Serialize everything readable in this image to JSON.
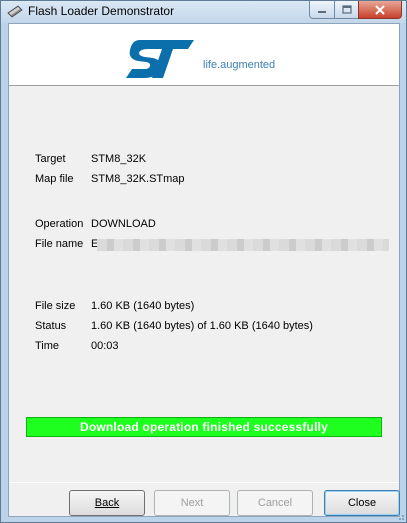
{
  "window": {
    "title": "Flash Loader Demonstrator"
  },
  "header": {
    "tagline": "life.augmented",
    "logo_icon": "st-logo"
  },
  "fields": {
    "target": {
      "label": "Target",
      "value": "STM8_32K"
    },
    "map_file": {
      "label": "Map file",
      "value": "STM8_32K.STmap"
    },
    "operation": {
      "label": "Operation",
      "value": "DOWNLOAD"
    },
    "file_name": {
      "label": "File name",
      "value": "E"
    },
    "file_size": {
      "label": "File size",
      "value": "1.60 KB (1640 bytes)"
    },
    "status": {
      "label": "Status",
      "value": "1.60 KB (1640 bytes) of 1.60 KB (1640 bytes)"
    },
    "time": {
      "label": "Time",
      "value": "00:03"
    }
  },
  "banner": {
    "text": "Download operation finished successfully",
    "color": "#1fff1f"
  },
  "buttons": {
    "back": "Back",
    "next": "Next",
    "cancel": "Cancel",
    "close": "Close"
  },
  "colors": {
    "accent": "#3b7fb9",
    "success": "#1fff1f"
  }
}
